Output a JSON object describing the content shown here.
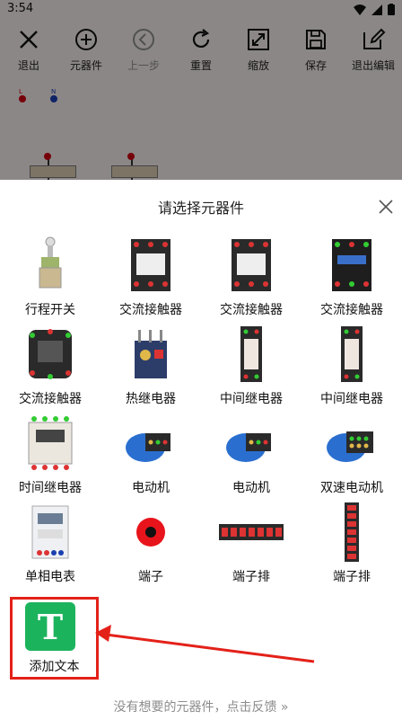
{
  "status": {
    "time": "3:54"
  },
  "toolbar": [
    {
      "label": "退出",
      "icon": "close-icon"
    },
    {
      "label": "元器件",
      "icon": "add-circle-icon"
    },
    {
      "label": "上一步",
      "icon": "back-circle-icon",
      "disabled": true
    },
    {
      "label": "重置",
      "icon": "refresh-icon"
    },
    {
      "label": "缩放",
      "icon": "zoom-icon"
    },
    {
      "label": "保存",
      "icon": "save-icon"
    },
    {
      "label": "退出编辑",
      "icon": "edit-icon"
    }
  ],
  "canvas": {
    "labels": [
      "L",
      "N"
    ]
  },
  "sheet": {
    "title": "请选择元器件",
    "components": [
      "行程开关",
      "交流接触器",
      "交流接触器",
      "交流接触器",
      "交流接触器",
      "热继电器",
      "中间继电器",
      "中间继电器",
      "时间继电器",
      "电动机",
      "电动机",
      "双速电动机",
      "单相电表",
      "端子",
      "端子排",
      "端子排"
    ],
    "add_text": {
      "label": "添加文本",
      "icon_letter": "T"
    },
    "footer": "没有想要的元器件，点击反馈 »"
  },
  "colors": {
    "accent_green": "#1cb35d",
    "highlight_red": "#e32119",
    "terminal_red": "#c01414"
  }
}
